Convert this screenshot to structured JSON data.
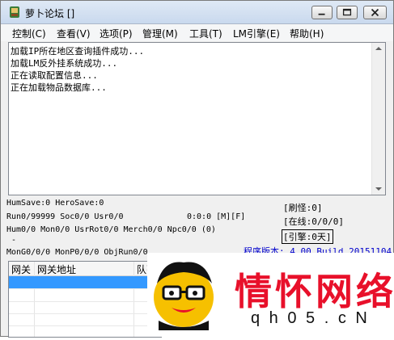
{
  "window": {
    "title": "萝卜论坛 []"
  },
  "menu": [
    {
      "label": "控制(C)"
    },
    {
      "label": "查看(V)"
    },
    {
      "label": "选项(P)"
    },
    {
      "label": "管理(M)"
    },
    {
      "label": "工具(T)"
    },
    {
      "label": "LM引擎(E)"
    },
    {
      "label": "帮助(H)"
    }
  ],
  "log": {
    "lines": [
      "加载IP所在地区查询插件成功...",
      "加载LM反外挂系统成功...",
      "正在读取配置信息...",
      "正在加载物品数据库..."
    ]
  },
  "status": {
    "line1": "HumSave:0 HeroSave:0",
    "line2_left": "Run0/99999 Soc0/0 Usr0/0",
    "line2_mid": "0:0:0 [M][F]",
    "line3": "Hum0/0 Mon0/0 UsrRot0/0 Merch0/0 Npc0/0 (0)",
    "line4": "-",
    "line5": "MonG0/0/0 MonP0/0/0 ObjRun0/0"
  },
  "right_status": {
    "refresh": "[刷怪:0]",
    "online": "[在线:0/0/0]",
    "engine": "[引擎:0天]",
    "version": "程序版本: 4.00 Build 20151104"
  },
  "table": {
    "headers": [
      "网关",
      "网关地址",
      "队列"
    ]
  },
  "watermark": {
    "text": "情怀网络",
    "url": "q h 0 5 . c N",
    "colors": {
      "red": "#e8102a",
      "black": "#111111",
      "yellow": "#f6c000"
    }
  }
}
